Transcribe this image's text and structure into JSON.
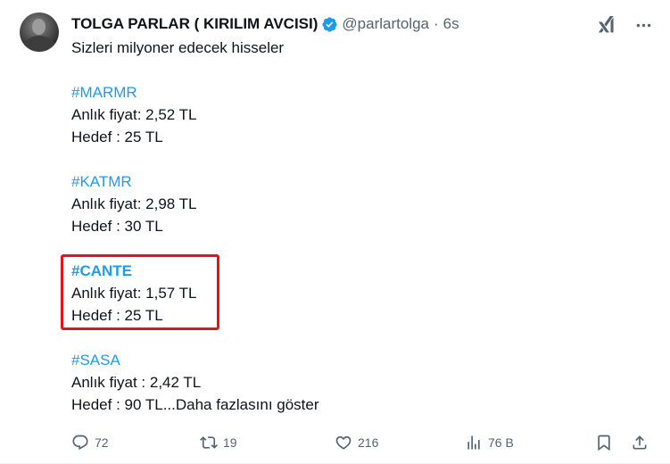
{
  "author": {
    "name": "TOLGA PARLAR ( KIRILIM AVCISI)",
    "handle": "@parlartolga",
    "separator": "·",
    "time": "6s"
  },
  "tweet_lines": [
    {
      "text": "Sizleri milyoner edecek hisseler",
      "type": "text"
    },
    {
      "text": "",
      "type": "gap"
    },
    {
      "text": "#MARMR",
      "type": "hashtag"
    },
    {
      "text": "Anlık fiyat: 2,52 TL",
      "type": "text"
    },
    {
      "text": "Hedef : 25 TL",
      "type": "text"
    },
    {
      "text": "",
      "type": "gap"
    },
    {
      "text": "#KATMR",
      "type": "hashtag"
    },
    {
      "text": "Anlık fiyat: 2,98 TL",
      "type": "text"
    },
    {
      "text": "Hedef : 30 TL",
      "type": "text"
    },
    {
      "text": "",
      "type": "gap"
    },
    {
      "text": "#CANTE",
      "type": "hashtag-bold"
    },
    {
      "text": "Anlık fiyat: 1,57 TL",
      "type": "text"
    },
    {
      "text": "Hedef : 25 TL",
      "type": "text"
    },
    {
      "text": "",
      "type": "gap"
    },
    {
      "text": "#SASA",
      "type": "hashtag"
    },
    {
      "text": "Anlık fiyat : 2,42 TL",
      "type": "text"
    },
    {
      "text": "Hedef : 90 TL...Daha fazlasını göster",
      "type": "text"
    }
  ],
  "stats": {
    "replies": "72",
    "retweets": "19",
    "likes": "216",
    "views": "76 B"
  },
  "colors": {
    "hashtag": "#1d9bf0",
    "highlight_box": "#e8121d",
    "muted": "#536471",
    "verified": "#1d9bf0"
  },
  "icons": [
    "grok-icon",
    "more-icon",
    "verified-badge-icon",
    "reply-icon",
    "retweet-icon",
    "like-icon",
    "views-icon",
    "bookmark-icon",
    "share-icon"
  ]
}
